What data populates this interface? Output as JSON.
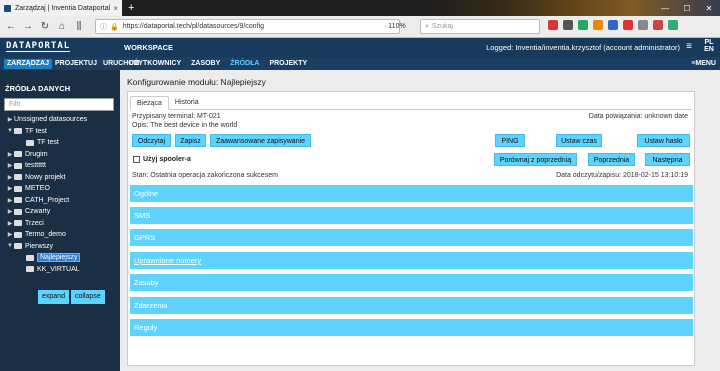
{
  "browser": {
    "tab_title": "Zarządzaj | Inventia Dataportal",
    "url": "https://dataportal.tech/pl/datasources/9/config",
    "url_domain": "dataportal.tech",
    "zoom": "110%",
    "search_placeholder": "Szukaj",
    "win_min": "—",
    "win_max": "☐",
    "win_close": "✕",
    "new_tab": "+",
    "tab_close": "×"
  },
  "app": {
    "logo": "DATAPORTAL",
    "workspace": "WORKSPACE",
    "logged": "Logged: Inventia/inventia.krzysztof (account administrator)",
    "lang_top": "PL",
    "lang_bottom": "EN",
    "hamburger": "≡"
  },
  "menu": {
    "left": [
      "ZARZĄDZAJ",
      "PROJEKTUJ",
      "URUCHOM"
    ],
    "right": [
      "UŻYTKOWNICY",
      "ZASOBY",
      "ŹRÓDŁA",
      "PROJEKTY"
    ],
    "menu_button": "≡MENU"
  },
  "sidebar": {
    "title": "ŹRÓDŁA DANYCH",
    "filter_placeholder": "Filtr",
    "nodes": [
      {
        "label": "Unssigned datasources",
        "indent": 0,
        "arrow": "▶",
        "folder": false
      },
      {
        "label": "TF test",
        "indent": 0,
        "arrow": "▼",
        "folder": true
      },
      {
        "label": "TF test",
        "indent": 1,
        "arrow": "",
        "folder": true
      },
      {
        "label": "Drugim",
        "indent": 0,
        "arrow": "▶",
        "folder": true
      },
      {
        "label": "testttttt",
        "indent": 0,
        "arrow": "▶",
        "folder": true
      },
      {
        "label": "Nowy projekt",
        "indent": 0,
        "arrow": "▶",
        "folder": true
      },
      {
        "label": "METEO",
        "indent": 0,
        "arrow": "▶",
        "folder": true
      },
      {
        "label": "CATH_Project",
        "indent": 0,
        "arrow": "▶",
        "folder": true
      },
      {
        "label": "Czwarty",
        "indent": 0,
        "arrow": "▶",
        "folder": true
      },
      {
        "label": "Trzeci",
        "indent": 0,
        "arrow": "▶",
        "folder": true
      },
      {
        "label": "Termo_demo",
        "indent": 0,
        "arrow": "▶",
        "folder": true
      },
      {
        "label": "Pierwszy",
        "indent": 0,
        "arrow": "▼",
        "folder": true
      },
      {
        "label": "Najlepiejszy",
        "indent": 1,
        "arrow": "",
        "folder": true,
        "selected": true
      },
      {
        "label": "KK_VIRTUAL",
        "indent": 1,
        "arrow": "",
        "folder": true
      }
    ],
    "expand": "expand",
    "collapse": "collapse"
  },
  "main": {
    "title": "Konfigurowanie modułu: Najlepiejszy",
    "tabs": [
      "Bieżąca",
      "Historia"
    ],
    "terminal": "Przypisany terminal: MT-021",
    "opis": "Opis: The best device in the world",
    "data_powiazania": "Data powiązania: unknown date",
    "buttons": {
      "odczytaj": "Odczytaj",
      "zapisz": "Zapisz",
      "zaawansowane": "Zaawansowane zapisywanie",
      "ping": "PING",
      "ustaw_czas": "Ustaw czas",
      "ustaw_haslo": "Ustaw hasło",
      "porownaj": "Porównaj z poprzednią",
      "poprzednia": "Poprzednia",
      "nastepna": "Następna"
    },
    "spooler": "Użyj spooler-a",
    "status": "Stan: Ostatnia operacja zakończona sukcesem",
    "data_odczytu": "Data odczytu/zapisu: 2018-02-15 13:10:19",
    "sections": [
      "Ogólne",
      "SMS",
      "GPRS",
      "Uprawnione numery",
      "Zasoby",
      "Zdarzenia",
      "Reguły"
    ]
  },
  "colors": {
    "header": "#173a5c",
    "sidebar": "#1b2f44",
    "accent": "#5fd3ff"
  }
}
